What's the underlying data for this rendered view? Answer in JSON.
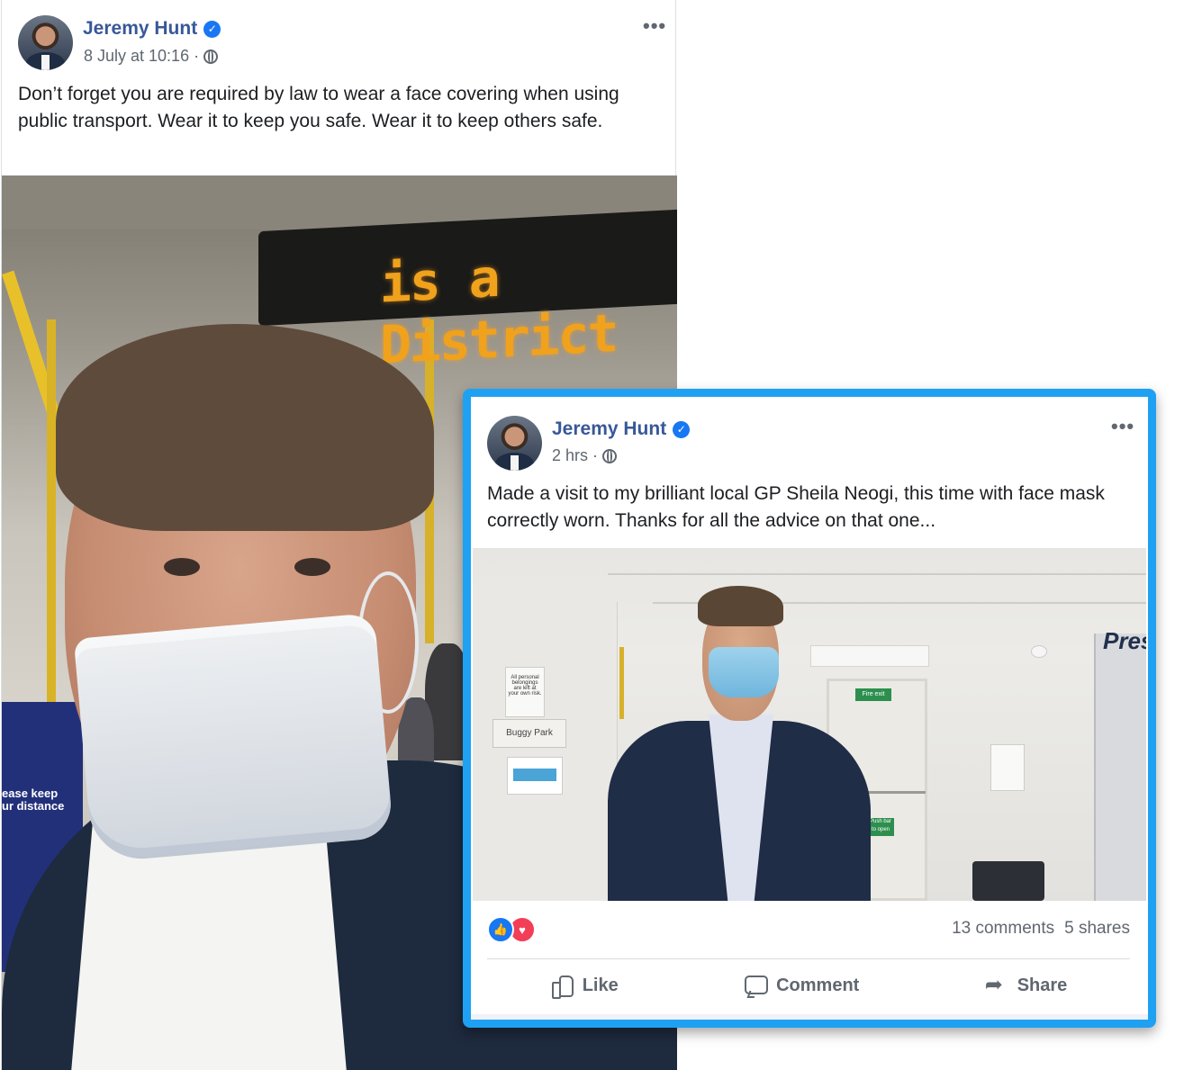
{
  "post1": {
    "author": "Jeremy Hunt",
    "timestamp": "8 July at 10:16",
    "separator": "·",
    "text": "Don’t forget you are required by law to wear a face covering when using public transport. Wear it to keep you safe. Wear it to keep others safe.",
    "more_label": "•••",
    "photo": {
      "led_sign": "is a District",
      "panel_text": "ease keep\nur distance"
    }
  },
  "post2": {
    "author": "Jeremy Hunt",
    "timestamp": "2 hrs",
    "separator": "·",
    "text": "Made a visit to my brilliant local GP Sheila Neogi, this time with face mask correctly worn. Thanks for all the advice on that one...",
    "more_label": "•••",
    "photo": {
      "buggy_sign": "Buggy Park",
      "notice_text": "All personal belongings are left at your own risk.",
      "fire_exit": "Fire exit",
      "push_bar": "Push bar to open",
      "pres_text": "Pres"
    },
    "comments": "13 comments",
    "shares": "5 shares",
    "actions": {
      "like": "Like",
      "comment": "Comment",
      "share": "Share"
    }
  },
  "colors": {
    "author_link": "#385898",
    "verified": "#1877f2",
    "highlight_frame": "#1ea1f2",
    "meta_gray": "#606770"
  }
}
